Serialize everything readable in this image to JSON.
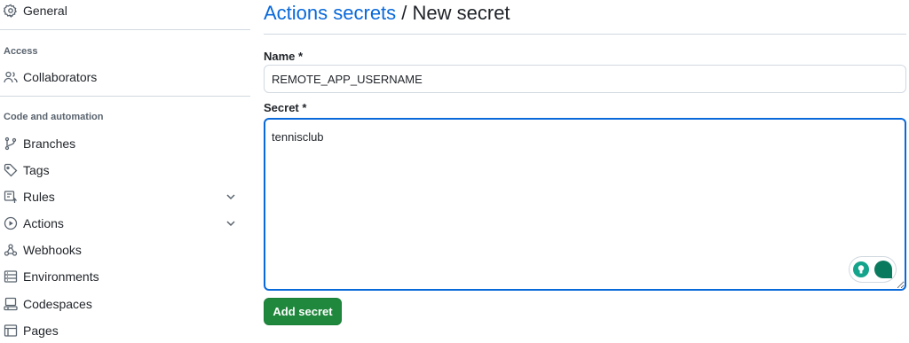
{
  "sidebar": {
    "general": {
      "label": "General",
      "icon": "gear-icon"
    },
    "access_label": "Access",
    "collaborators": {
      "label": "Collaborators",
      "icon": "people-icon"
    },
    "code_automation_label": "Code and automation",
    "items": [
      {
        "label": "Branches",
        "icon": "git-branch-icon"
      },
      {
        "label": "Tags",
        "icon": "tag-icon"
      },
      {
        "label": "Rules",
        "icon": "rules-icon",
        "expandable": true
      },
      {
        "label": "Actions",
        "icon": "play-icon",
        "expandable": true
      },
      {
        "label": "Webhooks",
        "icon": "webhook-icon"
      },
      {
        "label": "Environments",
        "icon": "server-icon"
      },
      {
        "label": "Codespaces",
        "icon": "codespaces-icon"
      },
      {
        "label": "Pages",
        "icon": "browser-icon"
      }
    ]
  },
  "main": {
    "breadcrumb_link": "Actions secrets",
    "breadcrumb_sep": " / ",
    "title": "New secret",
    "name_label": "Name *",
    "name_value": "REMOTE_APP_USERNAME",
    "secret_label": "Secret *",
    "secret_value": "tennisclub",
    "submit_label": "Add secret"
  },
  "colors": {
    "accent": "#0969da",
    "primary_button": "#1f883d"
  }
}
